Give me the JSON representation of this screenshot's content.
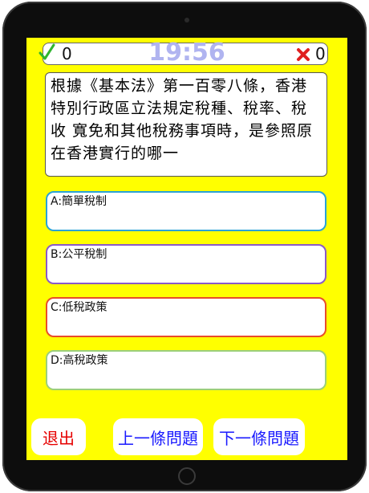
{
  "status": {
    "correct_count": "0",
    "timer": "19:56",
    "wrong_count": "0"
  },
  "question": {
    "text": "根據《基本法》第一百零八條，香港特別行政區立法規定稅種、稅率、稅收 寬免和其他稅務事項時，是參照原在香港實行的哪一"
  },
  "options": [
    {
      "label": "A:簡單稅制"
    },
    {
      "label": "B:公平稅制"
    },
    {
      "label": "C:低稅政策"
    },
    {
      "label": "D:高稅政策"
    }
  ],
  "buttons": {
    "exit_label": "退出",
    "prev_label": "上一條問題",
    "next_label": "下一條問題"
  },
  "colors": {
    "background": "#ffff00",
    "timer": "#b0b4f0",
    "exit_text": "#e60000",
    "nav_text": "#1a1aff"
  },
  "icons": {
    "correct": "check-icon",
    "wrong": "cross-icon"
  }
}
